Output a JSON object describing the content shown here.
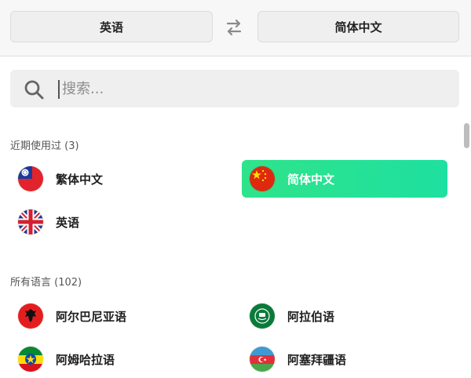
{
  "header": {
    "source_lang": "英语",
    "target_lang": "简体中文",
    "swap_icon": "swap-arrows-icon"
  },
  "search": {
    "placeholder": "搜索...",
    "value": "",
    "icon": "search-icon"
  },
  "recent": {
    "title": "近期使用过 (3)",
    "items": [
      {
        "label": "繁体中文",
        "flag": "taiwan-flag-icon",
        "selected": false
      },
      {
        "label": "简体中文",
        "flag": "china-flag-icon",
        "selected": true
      },
      {
        "label": "英语",
        "flag": "uk-flag-icon",
        "selected": false
      }
    ]
  },
  "all": {
    "title": "所有语言 (102)",
    "items": [
      {
        "label": "阿尔巴尼亚语",
        "flag": "albania-flag-icon"
      },
      {
        "label": "阿拉伯语",
        "flag": "arab-league-flag-icon"
      },
      {
        "label": "阿姆哈拉语",
        "flag": "ethiopia-flag-icon"
      },
      {
        "label": "阿塞拜疆语",
        "flag": "azerbaijan-flag-icon"
      }
    ]
  },
  "colors": {
    "selected_start": "#2fe38a",
    "selected_end": "#1ee0a0"
  }
}
